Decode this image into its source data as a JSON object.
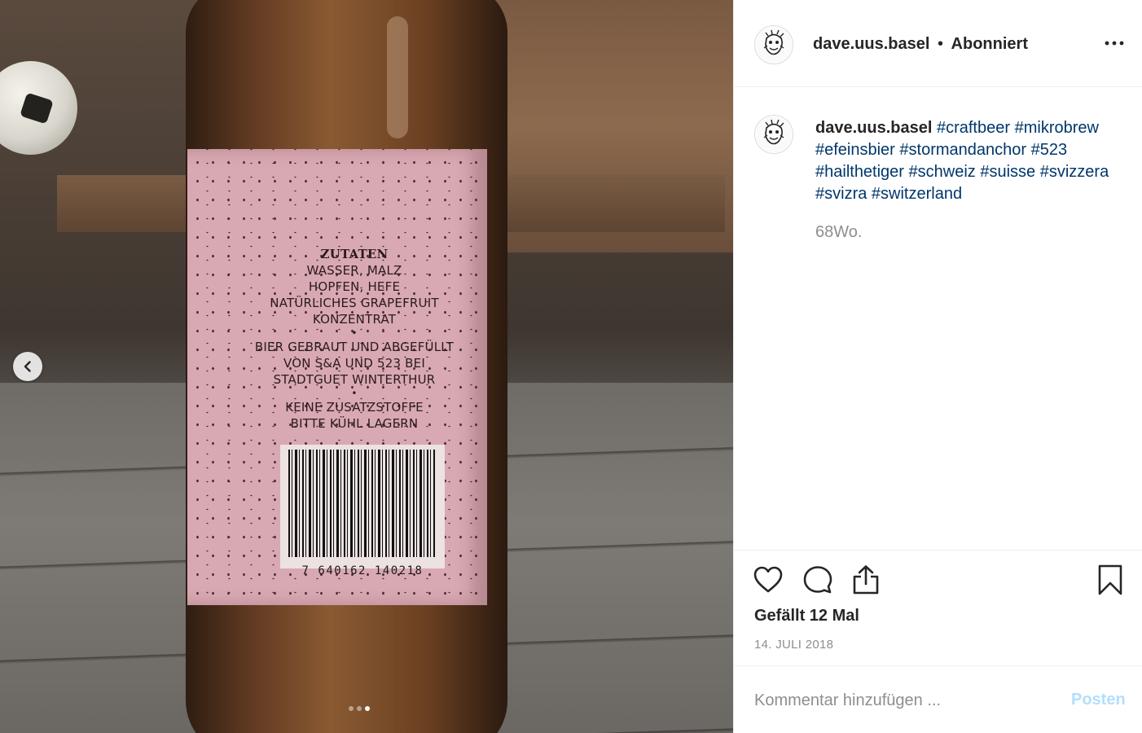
{
  "post": {
    "image_alt": "",
    "label": {
      "heading": "ZUTATEN",
      "line1": "WASSER, MALZ",
      "line2": "HOPFEN, HEFE",
      "line3": "NATÜRLICHES GRAPEFRUIT",
      "line4": "KONZENTRAT",
      "bullet": "•",
      "line5": "BIER GEBRAUT UND ABGEFÜLLT",
      "line6": "VON S&A UND 523 BEI",
      "line7": "STADTGUET WINTERTHUR",
      "line8": "KEINE ZUSATZSTOFFE",
      "line9": "BITTE KÜHL LAGERN",
      "barcode": "7 640162 140218"
    },
    "carousel": {
      "total": 3,
      "active_index": 2
    }
  },
  "header": {
    "username": "dave.uus.basel",
    "separator": "•",
    "follow_status": "Abonniert"
  },
  "caption": {
    "username": "dave.uus.basel",
    "hashtags": [
      "#craftbeer",
      "#mikrobrew",
      "#efeinsbier",
      "#stormandanchor",
      "#523",
      "#hailthetiger",
      "#schweiz",
      "#suisse",
      "#svizzera",
      "#svizra",
      "#switzerland"
    ],
    "time": "68Wo."
  },
  "actions": {
    "likes": "Gefällt 12 Mal",
    "date": "14. JULI 2018"
  },
  "comment": {
    "placeholder": "Kommentar hinzufügen ...",
    "post_label": "Posten"
  },
  "icons": {
    "prev": "chevron-left-icon",
    "more": "more-horizontal-icon",
    "like": "heart-icon",
    "comment": "comment-icon",
    "share": "share-icon",
    "save": "bookmark-icon"
  },
  "colors": {
    "hashtag": "#00376b",
    "post_button_disabled": "#b2dffc",
    "muted_text": "#8e8e8e",
    "label_pink": "#d9a9b3"
  }
}
